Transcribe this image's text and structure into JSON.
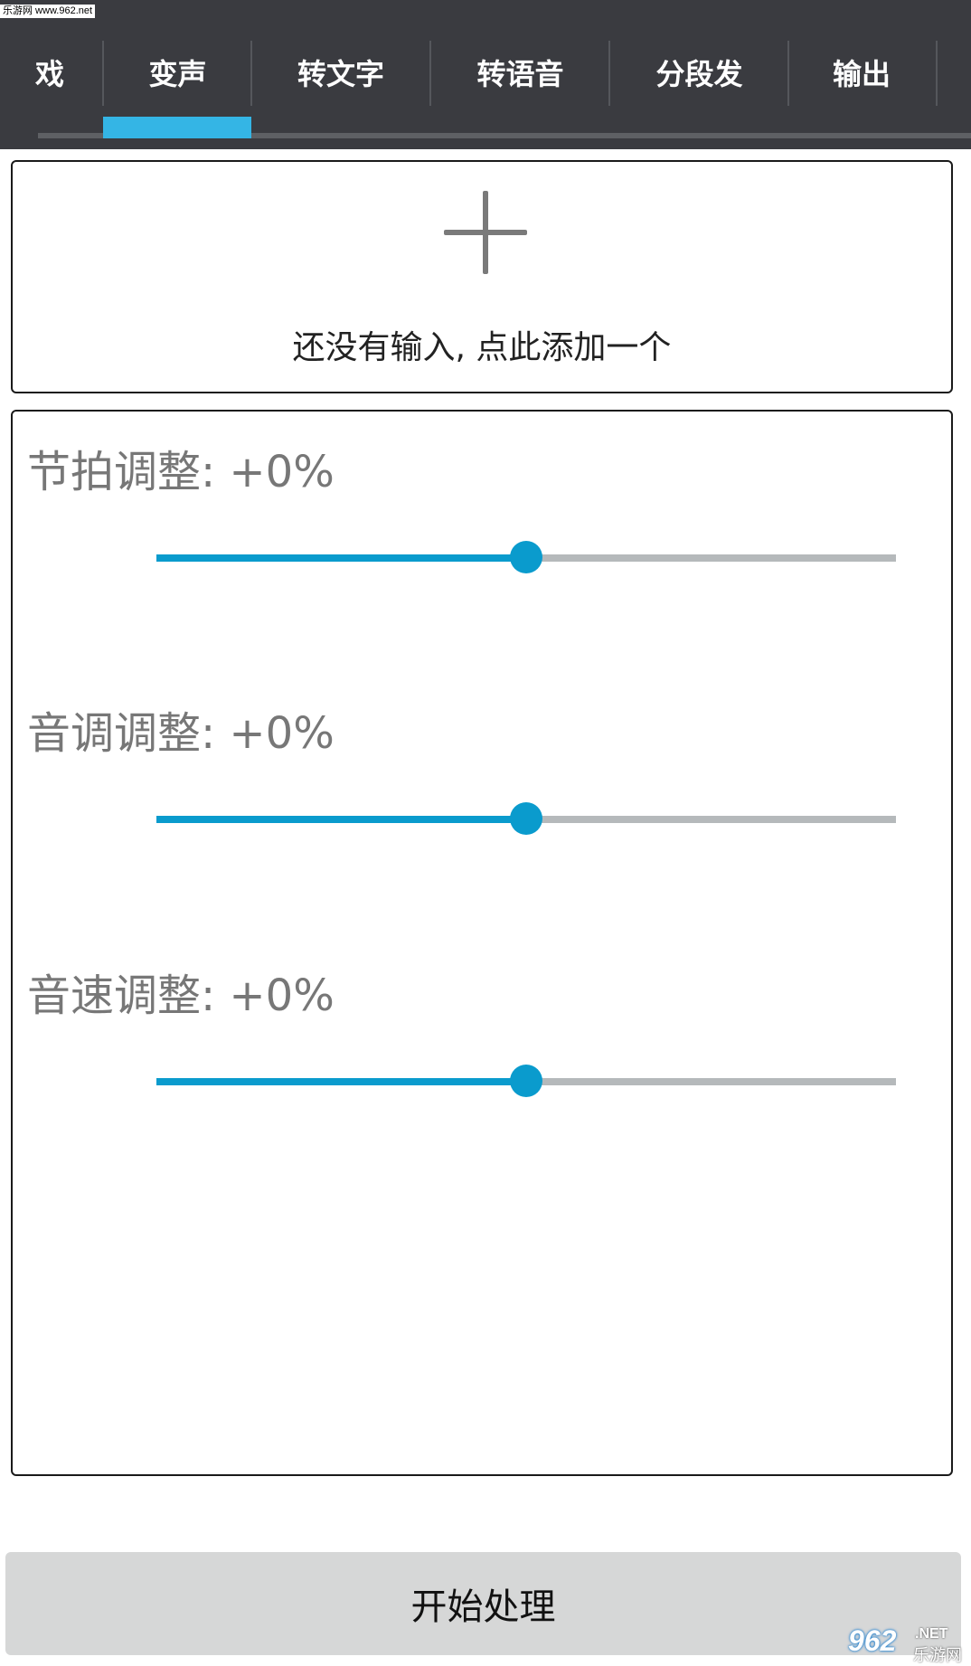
{
  "watermark": {
    "top_text": "乐游网 www.962.net",
    "logo_number": "962",
    "logo_suffix": ".NET",
    "logo_cn": "乐游网"
  },
  "tabs": [
    {
      "label": "戏",
      "active": false
    },
    {
      "label": "变声",
      "active": true
    },
    {
      "label": "转文字",
      "active": false
    },
    {
      "label": "转语音",
      "active": false
    },
    {
      "label": "分段发",
      "active": false
    },
    {
      "label": "输出",
      "active": false
    }
  ],
  "input_panel": {
    "icon": "plus-icon",
    "hint": "还没有输入, 点此添加一个"
  },
  "sliders": [
    {
      "label": "节拍调整: +0%",
      "value_fraction": 0.5
    },
    {
      "label": "音调调整: +0%",
      "value_fraction": 0.5
    },
    {
      "label": "音速调整: +0%",
      "value_fraction": 0.5
    }
  ],
  "start_button": {
    "label": "开始处理"
  },
  "colors": {
    "tabbar_bg": "#3a3b40",
    "tab_indicator": "#34b5e5",
    "slider_accent": "#0a9bcd",
    "slider_track": "#b5b9bb",
    "button_bg": "#d6d7d7"
  }
}
